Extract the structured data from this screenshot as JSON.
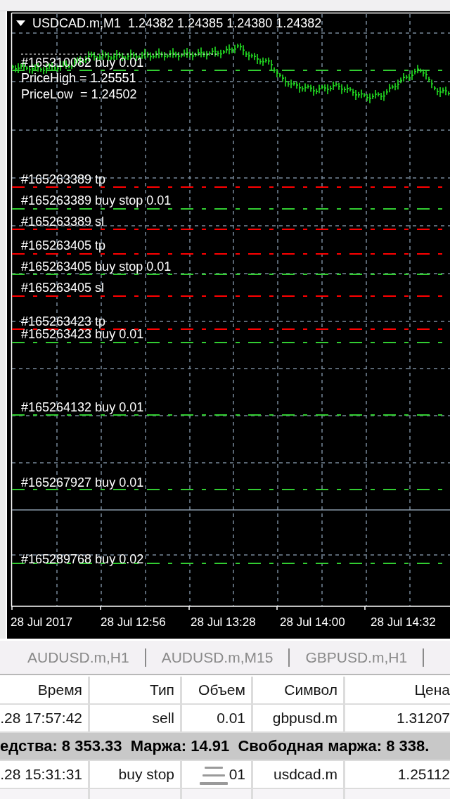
{
  "chart": {
    "title": "USDCAD.m,M1  1.24382 1.24385 1.24380 1.24382",
    "comment_lines": [
      "PriceHigh = 1.25551",
      "PriceLow  = 1.24502"
    ],
    "order_lines": [
      {
        "label": "#165310082 buy 0.01",
        "kind": "order"
      },
      {
        "label": "#165263389 tp",
        "kind": "tp"
      },
      {
        "label": "#165263389 buy stop 0.01",
        "kind": "order"
      },
      {
        "label": "#165263389 sl",
        "kind": "sl"
      },
      {
        "label": "#165263405 tp",
        "kind": "tp"
      },
      {
        "label": "#165263405 buy stop 0.01",
        "kind": "order"
      },
      {
        "label": "#165263405 sl",
        "kind": "sl"
      },
      {
        "label": "#165263423 tp",
        "kind": "tp"
      },
      {
        "label": "#165263423 buy 0.01",
        "kind": "order"
      },
      {
        "label": "#165264132 buy 0.01",
        "kind": "order"
      },
      {
        "label": "#165267927 buy 0.01",
        "kind": "order"
      },
      {
        "label": "#165289768 buy 0.02",
        "kind": "order"
      }
    ],
    "time_axis": [
      "28 Jul 2017",
      "28 Jul 12:56",
      "28 Jul 13:28",
      "28 Jul 14:00",
      "28 Jul 14:32"
    ]
  },
  "chart_tabs": [
    {
      "label": "AUDUSD.m,H1",
      "selected": false
    },
    {
      "label": "AUDUSD.m,M15",
      "selected": false
    },
    {
      "label": "GBPUSD.m,H1",
      "selected": false
    }
  ],
  "trade_table": {
    "columns": [
      "Время",
      "Тип",
      "Объем",
      "Символ",
      "Цена"
    ],
    "rows": [
      {
        "kind": "order",
        "cells": [
          ".28 17:57:42",
          "sell",
          "0.01",
          "gbpusd.m",
          "1.31207"
        ]
      },
      {
        "kind": "summary",
        "text": "едства: 8 353.33  Маржа: 14.91  Свободная маржа: 8 338."
      },
      {
        "kind": "order",
        "cells": [
          ".28 15:31:31",
          "buy stop",
          "01",
          "usdcad.m",
          "1.25112"
        ]
      }
    ]
  }
}
